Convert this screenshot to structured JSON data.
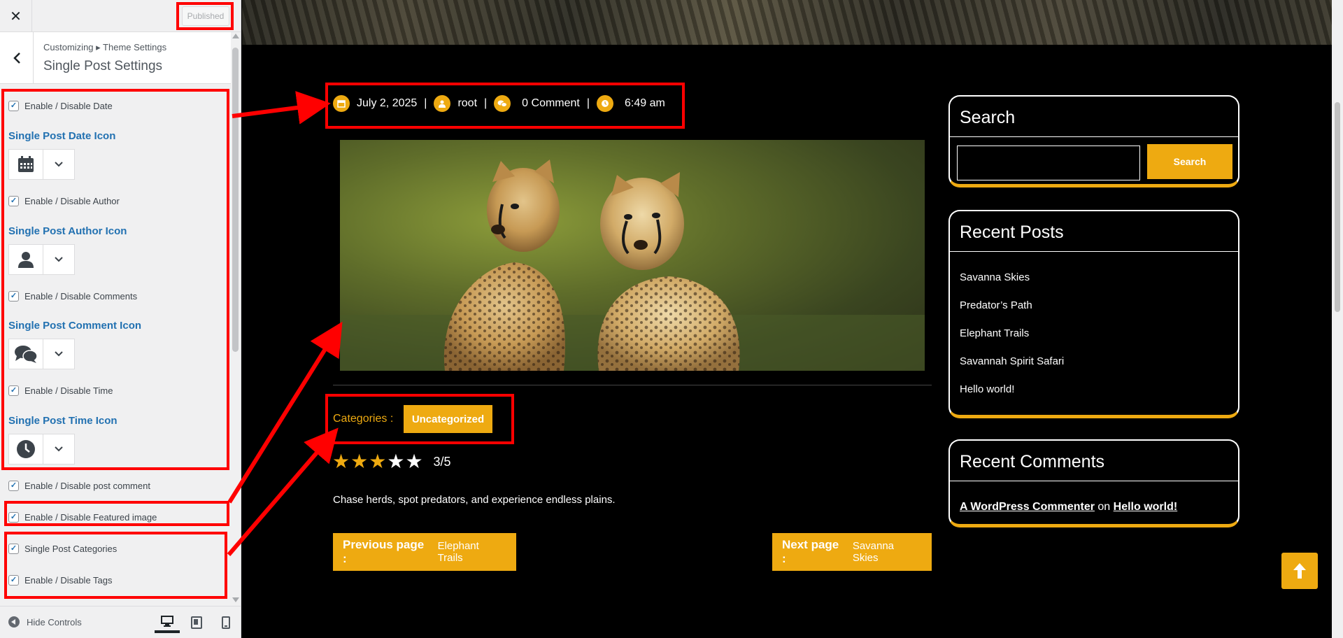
{
  "customizer": {
    "close_icon": "close-icon",
    "publish_label": "Published",
    "breadcrumb": "Customizing ▸ Theme Settings",
    "panel_title": "Single Post Settings",
    "controls": [
      {
        "type": "checkbox",
        "label": "Enable / Disable Date",
        "checked": true
      },
      {
        "type": "section",
        "label": "Single Post Date Icon",
        "icon": "calendar-icon"
      },
      {
        "type": "checkbox",
        "label": "Enable / Disable Author",
        "checked": true
      },
      {
        "type": "section",
        "label": "Single Post Author Icon",
        "icon": "user-icon"
      },
      {
        "type": "checkbox",
        "label": "Enable / Disable Comments",
        "checked": true
      },
      {
        "type": "section",
        "label": "Single Post Comment Icon",
        "icon": "comments-icon"
      },
      {
        "type": "checkbox",
        "label": "Enable / Disable Time",
        "checked": true
      },
      {
        "type": "section",
        "label": "Single Post Time Icon",
        "icon": "clock-icon"
      },
      {
        "type": "checkbox",
        "label": "Enable / Disable post comment",
        "checked": true
      },
      {
        "type": "checkbox",
        "label": "Enable / Disable Featured image",
        "checked": true
      },
      {
        "type": "checkbox",
        "label": "Single Post Categories",
        "checked": true
      },
      {
        "type": "checkbox",
        "label": "Enable / Disable Tags",
        "checked": true
      }
    ],
    "hide_controls_label": "Hide Controls",
    "devices": [
      "desktop-icon",
      "tablet-icon",
      "mobile-icon"
    ]
  },
  "post": {
    "date": "July 2, 2025",
    "author": "root",
    "comments": "0 Comment",
    "time": "6:49 am",
    "separator": "|",
    "categories_label": "Categories :",
    "category": "Uncategorized",
    "rating": 3,
    "rating_max": 5,
    "rating_text": "3/5",
    "excerpt": "Chase herds, spot predators, and experience endless plains.",
    "prev_label": "Previous page :",
    "prev_title": "Elephant Trails",
    "next_label": "Next page :",
    "next_title": "Savanna Skies"
  },
  "sidebar": {
    "search_title": "Search",
    "search_button": "Search",
    "recent_posts_title": "Recent Posts",
    "recent_posts": [
      "Savanna Skies",
      "Predator’s Path",
      "Elephant Trails",
      "Savannah Spirit Safari",
      "Hello world!"
    ],
    "recent_comments_title": "Recent Comments",
    "comment_author": "A WordPress Commenter",
    "comment_on": "on",
    "comment_post": "Hello world!"
  },
  "colors": {
    "accent": "#eeaa11",
    "annotation": "#ff0000",
    "customizer_link": "#2271b1"
  }
}
